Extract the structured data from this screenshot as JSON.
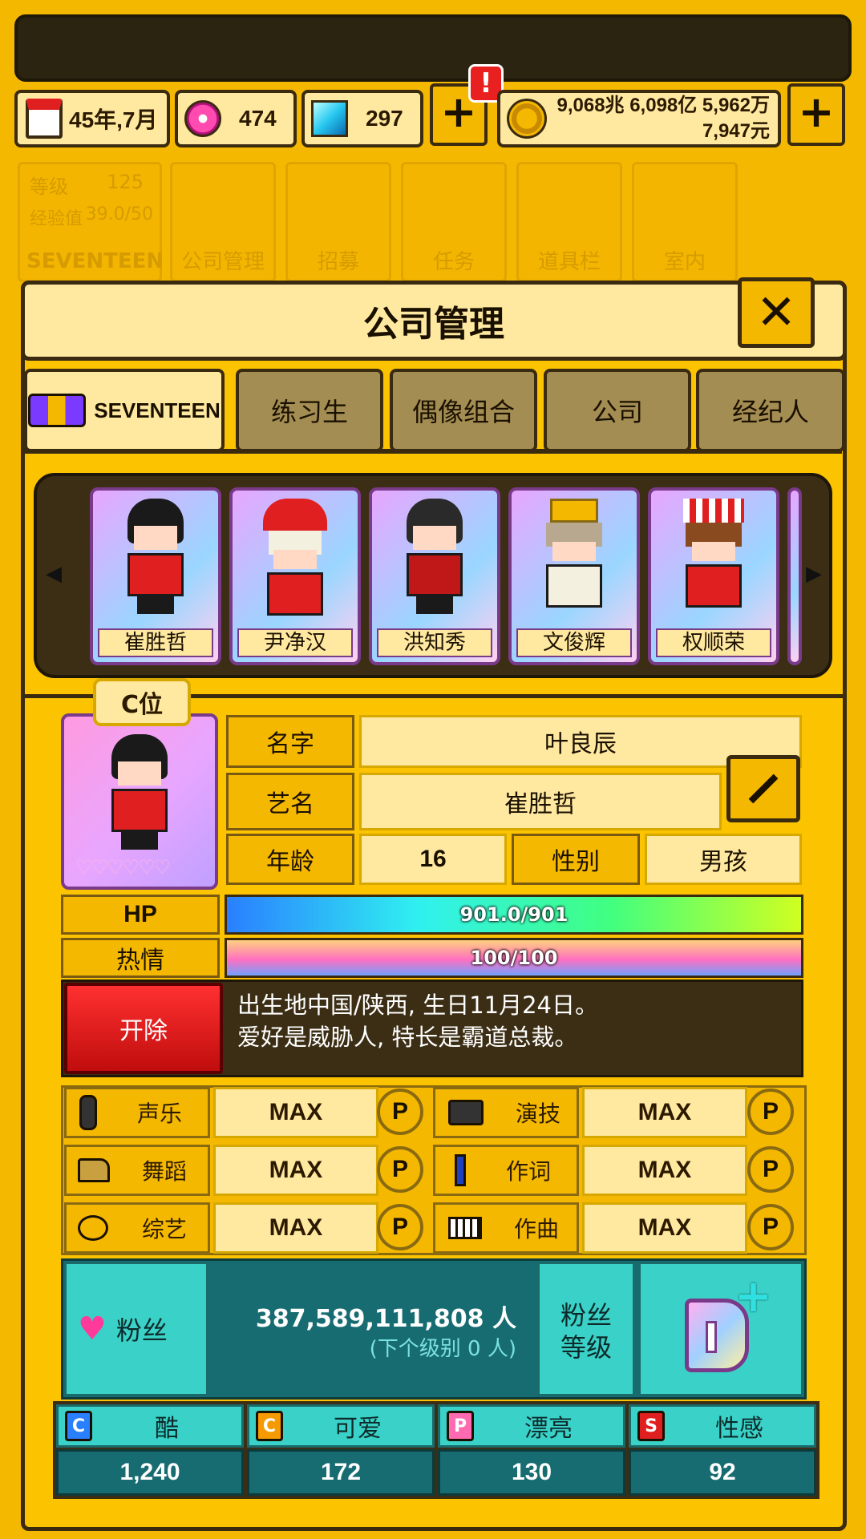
{
  "header": {
    "date": "45年,7月",
    "gems_pink": "474",
    "gems_blue": "297",
    "money_line1": "9,068兆 6,098亿 5,962万",
    "money_line2": "7,947元",
    "alert_mark": "!"
  },
  "bg_nav": {
    "level_label": "等级",
    "level_value": "125",
    "exp_label": "经验值",
    "exp_value": "39.0/50",
    "group_name": "SEVENTEEN",
    "items": [
      "公司管理",
      "招募",
      "任务",
      "道具栏",
      "室内"
    ]
  },
  "dialog": {
    "title": "公司管理",
    "close_icon": "close-icon"
  },
  "tabs": [
    {
      "label": "SEVENTEEN",
      "active": true
    },
    {
      "label": "练习生"
    },
    {
      "label": "偶像组合"
    },
    {
      "label": "公司"
    },
    {
      "label": "经纪人"
    }
  ],
  "members": [
    "崔胜哲",
    "尹净汉",
    "洪知秀",
    "文俊辉",
    "权顺荣"
  ],
  "profile": {
    "position": "C位",
    "name_label": "名字",
    "name_value": "叶良辰",
    "stage_label": "艺名",
    "stage_value": "崔胜哲",
    "age_label": "年龄",
    "age_value": "16",
    "gender_label": "性别",
    "gender_value": "男孩",
    "hearts": 6
  },
  "bars": {
    "hp_label": "HP",
    "hp_text": "901.0/901",
    "hp_fraction": 1.0,
    "passion_label": "热情",
    "passion_text": "100/100",
    "passion_fraction": 1.0
  },
  "actions": {
    "fire_label": "开除"
  },
  "bio": {
    "line1": "出生地中国/陕西, 生日11月24日。",
    "line2": "爱好是威胁人, 特长是霸道总裁。"
  },
  "skills": [
    {
      "label": "声乐",
      "value": "MAX",
      "icon": "microphone-icon"
    },
    {
      "label": "演技",
      "value": "MAX",
      "icon": "camera-icon"
    },
    {
      "label": "舞蹈",
      "value": "MAX",
      "icon": "shoe-icon"
    },
    {
      "label": "作词",
      "value": "MAX",
      "icon": "pen-icon"
    },
    {
      "label": "综艺",
      "value": "MAX",
      "icon": "variety-icon"
    },
    {
      "label": "作曲",
      "value": "MAX",
      "icon": "piano-icon"
    }
  ],
  "p_label": "P",
  "fans": {
    "label": "粉丝",
    "count": "387,589,111,808 人",
    "next": "(下个级别 0 人)",
    "level_label_1": "粉丝",
    "level_label_2": "等级"
  },
  "stats": [
    {
      "badge": "C",
      "label": "酷",
      "value": "1,240",
      "color": "#2a7fff"
    },
    {
      "badge": "C",
      "label": "可爱",
      "value": "172",
      "color": "#f59a00"
    },
    {
      "badge": "P",
      "label": "漂亮",
      "value": "130",
      "color": "#ff6ab0"
    },
    {
      "badge": "S",
      "label": "性感",
      "value": "92",
      "color": "#e02020"
    }
  ]
}
